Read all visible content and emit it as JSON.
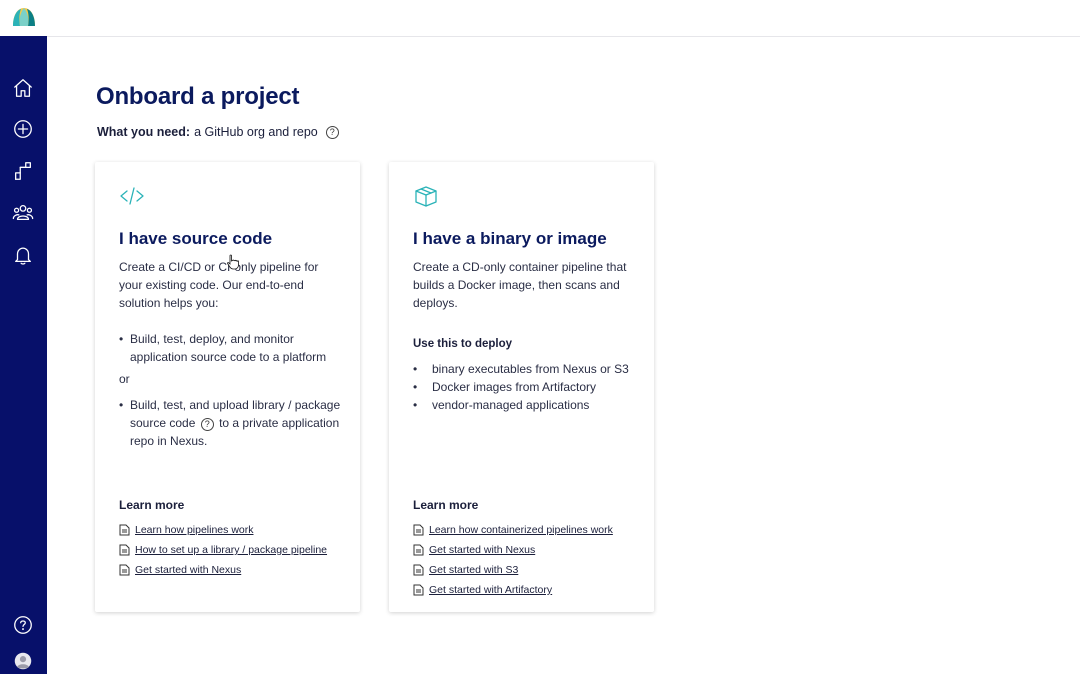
{
  "page": {
    "title": "Onboard a project",
    "need_label": "What you need:",
    "need_text": "a GitHub org and repo",
    "help_glyph": "?"
  },
  "sidebar": {
    "icons": [
      "home-icon",
      "add-circle-icon",
      "pipeline-icon",
      "team-icon",
      "bell-icon",
      "help-icon",
      "avatar-icon"
    ]
  },
  "cards": [
    {
      "icon": "code-icon",
      "title": "I have source code",
      "description": "Create a CI/CD or CI-only pipeline for your existing code. Our end-to-end solution helps you:",
      "bullet_1": "Build, test, deploy, and monitor application source code to a platform",
      "or": "or",
      "bullet_2_a": "Build, test, and upload library / package source code",
      "bullet_2_b": "to a private application repo in Nexus.",
      "learn_more": "Learn more",
      "links": [
        "Learn how pipelines work",
        "How to set up a library / package pipeline",
        "Get started with Nexus"
      ]
    },
    {
      "icon": "box-icon",
      "title": "I have a binary or image",
      "description": "Create a CD-only container pipeline that builds a Docker image,  then scans and deploys.",
      "section_label": "Use this to deploy",
      "bullets": [
        "binary executables from Nexus or S3",
        "Docker images from Artifactory",
        "vendor-managed applications"
      ],
      "learn_more": "Learn more",
      "links": [
        "Learn how containerized pipelines work",
        "Get started with Nexus",
        "Get started with S3",
        "Get started with Artifactory"
      ]
    }
  ],
  "colors": {
    "sidebar": "#07106a",
    "title": "#0b1a5e",
    "accent_icon": "#2bb3b8"
  }
}
